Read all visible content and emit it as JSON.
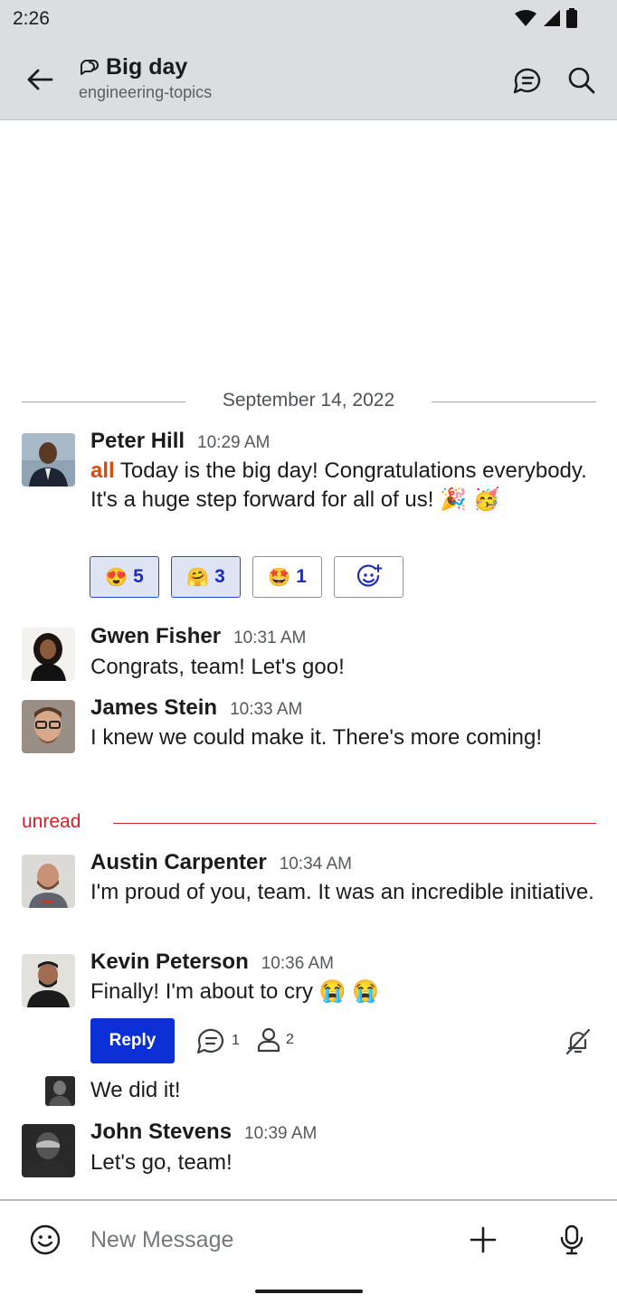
{
  "status_bar": {
    "time": "2:26",
    "icons": [
      "wifi-icon",
      "signal-icon",
      "battery-icon"
    ]
  },
  "header": {
    "title": "Big day",
    "subtitle": "engineering-topics",
    "topic_icon": "chat-bubble-icon",
    "icons": [
      "back-arrow-icon",
      "thread-icon",
      "search-icon"
    ]
  },
  "date_divider": "September 14, 2022",
  "messages": [
    {
      "author": "Peter Hill",
      "time": "10:29 AM",
      "mention": "all",
      "text": " Today is the big day! Congratulations everybody. It's a huge step forward for all of us! 🎉 🥳"
    },
    {
      "author": "Gwen Fisher",
      "time": "10:31 AM",
      "text": "Congrats, team! Let's goo!"
    },
    {
      "author": "James Stein",
      "time": "10:33 AM",
      "text": "I knew we could make it. There's more coming!"
    },
    {
      "author": "Austin Carpenter",
      "time": "10:34 AM",
      "text": "I'm proud of you, team. It was an incredible initiative."
    },
    {
      "author": "Kevin Peterson",
      "time": "10:36 AM",
      "text": "Finally! I'm about to cry 😭 😭"
    },
    {
      "author": "",
      "time": "",
      "text": "We did it!"
    },
    {
      "author": "John Stevens",
      "time": "10:39 AM",
      "text": "Let's go, team!"
    }
  ],
  "reactions": [
    {
      "emoji": "😍",
      "count": "5",
      "selected": true
    },
    {
      "emoji": "🤗",
      "count": "3",
      "selected": true
    },
    {
      "emoji": "🤩",
      "count": "1",
      "selected": false
    }
  ],
  "add_reaction_icon": "add-reaction-icon",
  "unread_label": "unread",
  "thread": {
    "reply_label": "Reply",
    "replies_count": "1",
    "participants_count": "2",
    "icons": [
      "replies-icon",
      "participants-icon",
      "mute-icon"
    ]
  },
  "composer": {
    "placeholder": "New Message",
    "icons": [
      "emoji-icon",
      "add-icon",
      "microphone-icon"
    ]
  },
  "colors": {
    "accent": "#0b31d6",
    "mention": "#dd4a11",
    "unread": "#d8202a",
    "header_bg": "#dcdde1"
  }
}
